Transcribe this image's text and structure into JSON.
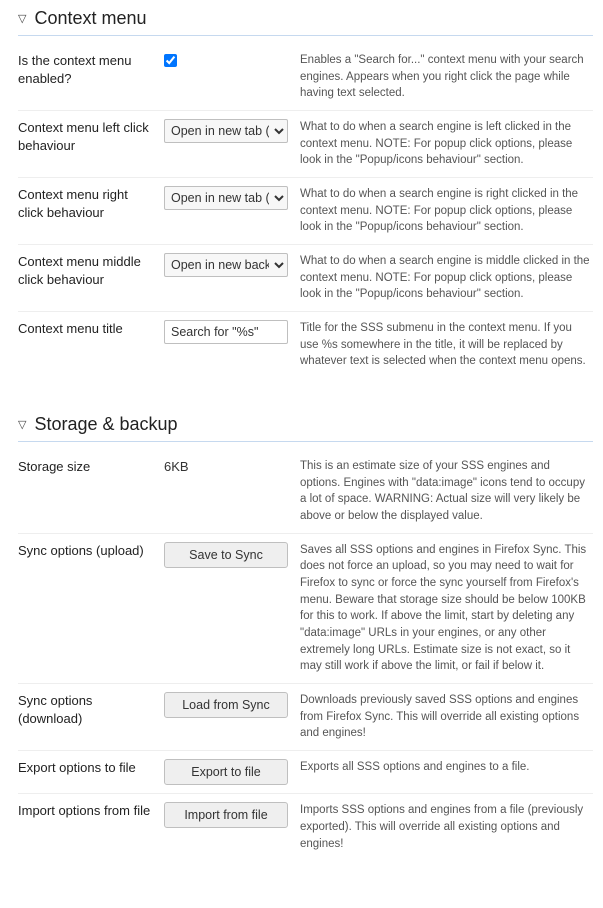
{
  "sections": {
    "context_menu": {
      "title": "Context menu",
      "rows": {
        "enabled": {
          "label": "Is the context menu enabled?",
          "checked": true,
          "desc": "Enables a \"Search for...\" context menu with your search engines. Appears when you right click the page while having text selected."
        },
        "left_click": {
          "label": "Context menu left click behaviour",
          "value": "Open in new tab (next to current tab)",
          "desc": "What to do when a search engine is left clicked in the context menu.\nNOTE: For popup click options, please look in the \"Popup/icons behaviour\" section."
        },
        "right_click": {
          "label": "Context menu right click behaviour",
          "value": "Open in new tab (next to current tab)",
          "desc": "What to do when a search engine is right clicked in the context menu.\nNOTE: For popup click options, please look in the \"Popup/icons behaviour\" section."
        },
        "middle_click": {
          "label": "Context menu middle click behaviour",
          "value": "Open in new background tab",
          "desc": "What to do when a search engine is middle clicked in the context menu.\nNOTE: For popup click options, please look in the \"Popup/icons behaviour\" section."
        },
        "title": {
          "label": "Context menu title",
          "value": "Search for \"%s\"",
          "desc": "Title for the SSS submenu in the context menu. If you use %s somewhere in the title, it will be replaced by whatever text is selected when the context menu opens."
        }
      }
    },
    "storage": {
      "title": "Storage & backup",
      "rows": {
        "size": {
          "label": "Storage size",
          "value": "6KB",
          "desc": "This is an estimate size of your SSS engines and options. Engines with \"data:image\" icons tend to occupy a lot of space. WARNING: Actual size will very likely be above or below the displayed value."
        },
        "sync_upload": {
          "label": "Sync options (upload)",
          "button": "Save to Sync",
          "desc": "Saves all SSS options and engines in Firefox Sync. This does not force an upload, so you may need to wait for Firefox to sync or force the sync yourself from Firefox's menu. Beware that storage size should be below 100KB for this to work. If above the limit, start by deleting any \"data:image\" URLs in your engines, or any other extremely long URLs. Estimate size is not exact, so it may still work if above the limit, or fail if below it."
        },
        "sync_download": {
          "label": "Sync options (download)",
          "button": "Load from Sync",
          "desc": "Downloads previously saved SSS options and engines from Firefox Sync. This will override all existing options and engines!"
        },
        "export": {
          "label": "Export options to file",
          "button": "Export to file",
          "desc": "Exports all SSS options and engines to a file."
        },
        "import": {
          "label": "Import options from file",
          "button": "Import from file",
          "desc": "Imports SSS options and engines from a file (previously exported). This will override all existing options and engines!"
        }
      }
    }
  }
}
